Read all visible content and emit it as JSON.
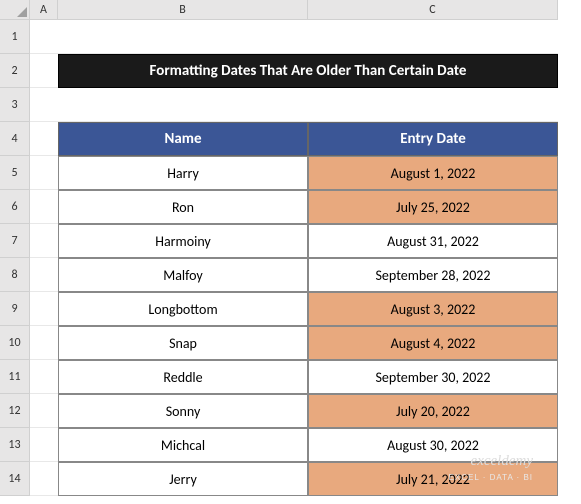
{
  "columns": [
    "",
    "A",
    "B",
    "C"
  ],
  "rows": [
    "1",
    "2",
    "3",
    "4",
    "5",
    "6",
    "7",
    "8",
    "9",
    "10",
    "11",
    "12",
    "13",
    "14"
  ],
  "title": "Formatting Dates That Are Older Than Certain Date",
  "headers": {
    "name": "Name",
    "date": "Entry Date"
  },
  "data": [
    {
      "name": "Harry",
      "date": "August 1, 2022",
      "hl": true
    },
    {
      "name": "Ron",
      "date": "July 25, 2022",
      "hl": true
    },
    {
      "name": "Harmoiny",
      "date": "August 31, 2022",
      "hl": false
    },
    {
      "name": "Malfoy",
      "date": "September 28, 2022",
      "hl": false
    },
    {
      "name": "Longbottom",
      "date": "August 3, 2022",
      "hl": true
    },
    {
      "name": "Snap",
      "date": "August 4, 2022",
      "hl": true
    },
    {
      "name": "Reddle",
      "date": "September 30, 2022",
      "hl": false
    },
    {
      "name": "Sonny",
      "date": "July 20, 2022",
      "hl": true
    },
    {
      "name": "Michcal",
      "date": "August 30, 2022",
      "hl": false
    },
    {
      "name": "Jerry",
      "date": "July 21, 2022",
      "hl": true
    }
  ],
  "watermark": {
    "main": "exceldemy",
    "sub": "EXCEL · DATA · BI"
  },
  "chart_data": {
    "type": "table",
    "title": "Formatting Dates That Are Older Than Certain Date",
    "columns": [
      "Name",
      "Entry Date"
    ],
    "rows": [
      [
        "Harry",
        "August 1, 2022"
      ],
      [
        "Ron",
        "July 25, 2022"
      ],
      [
        "Harmoiny",
        "August 31, 2022"
      ],
      [
        "Malfoy",
        "September 28, 2022"
      ],
      [
        "Longbottom",
        "August 3, 2022"
      ],
      [
        "Snap",
        "August 4, 2022"
      ],
      [
        "Reddle",
        "September 30, 2022"
      ],
      [
        "Sonny",
        "July 20, 2022"
      ],
      [
        "Michcal",
        "August 30, 2022"
      ],
      [
        "Jerry",
        "July 21, 2022"
      ]
    ],
    "highlighted_rows": [
      0,
      1,
      4,
      5,
      7,
      9
    ],
    "highlight_color": "#e8a97e"
  }
}
